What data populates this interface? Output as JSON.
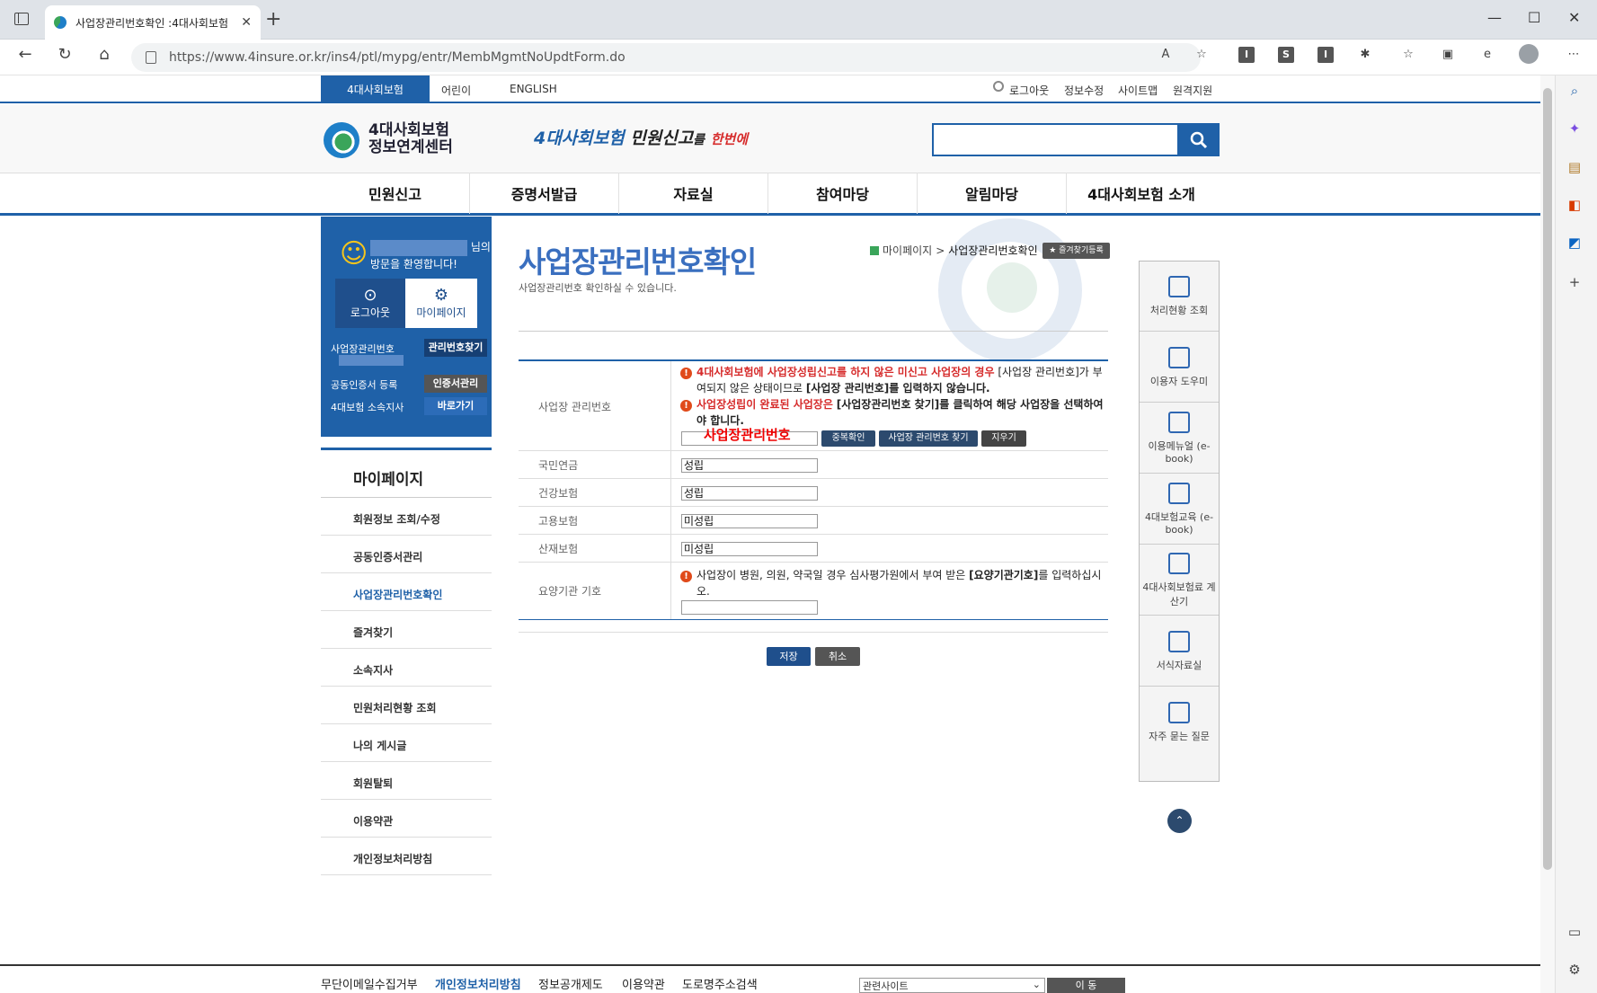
{
  "browser": {
    "tab_title": "사업장관리번호확인 :4대사회보험",
    "new_tab": "+",
    "url": "https://www.4insure.or.kr/ins4/ptl/mypg/entr/MembMgmtNoUpdtForm.do",
    "win_min": "—",
    "win_max": "☐",
    "win_close": "✕"
  },
  "util": {
    "brand": "4대사회보험",
    "kids": "어린이",
    "english": "ENGLISH",
    "logout": "로그아웃",
    "edit_info": "정보수정",
    "sitemap": "사이트맵",
    "remote": "원격지원"
  },
  "header": {
    "logo_line1": "4대사회보험",
    "logo_line2": "정보연계센터",
    "slogan_a": "4대사회보험",
    "slogan_b": "민원신고",
    "slogan_c": "를",
    "slogan_d": "한번에"
  },
  "gnb": [
    "민원신고",
    "증명서발급",
    "자료실",
    "참여마당",
    "알림마당",
    "4대사회보험 소개"
  ],
  "left_box": {
    "suffix": "님의",
    "welcome": "방문을 환영합니다!",
    "logout": "로그아웃",
    "mypage": "마이페이지",
    "row1": "사업장관리번호",
    "row1_btn": "관리번호찾기",
    "row2": "공동인증서 등록",
    "row2_btn": "인증서관리",
    "row3": "4대보험 소속지사",
    "row3_btn": "바로가기"
  },
  "lnb": {
    "title": "마이페이지",
    "items": [
      "회원정보 조회/수정",
      "공동인증서관리",
      "사업장관리번호확인",
      "즐겨찾기",
      "소속지사",
      "민원처리현황 조회",
      "나의 게시글",
      "회원탈퇴",
      "이용약관",
      "개인정보처리방침"
    ]
  },
  "content": {
    "title": "사업장관리번호확인",
    "subtitle": "사업장관리번호 확인하실 수 있습니다.",
    "breadcrumb_home": "마이페이지",
    "breadcrumb_sep": ">",
    "breadcrumb_current": "사업장관리번호확인",
    "fav_button": "즐겨찾기등록"
  },
  "form": {
    "bizno_label": "사업장 관리번호",
    "warn1_r": "4대사회보험에 사업장성립신고를 하지 않은 미신고 사업장의 경우",
    "warn1_a": "[사업장 관리번호]가 부여되지 않은 상태이므로",
    "warn1_k": "[사업장 관리번호]를 입력하지 않습니다.",
    "warn2_r": "사업장성립이 완료된 사업장은",
    "warn2_k": "[사업장관리번호 찾기]를 클릭하여 해당 사업장을 선택하여야 합니다.",
    "bizno_overlay": "사업장관리번호",
    "btn_dup": "중복확인",
    "btn_find": "사업장 관리번호 찾기",
    "btn_clear": "지우기",
    "rows": [
      {
        "label": "국민연금",
        "value": "성립"
      },
      {
        "label": "건강보험",
        "value": "성립"
      },
      {
        "label": "고용보험",
        "value": "미성립"
      },
      {
        "label": "산재보험",
        "value": "미성립"
      }
    ],
    "med_label": "요양기관 기호",
    "med_warn_a": "사업장이 병원, 의원, 약국일 경우 심사평가원에서 부여 받은",
    "med_warn_k": "[요양기관기호]",
    "med_warn_b": "를 입력하십시오.",
    "save": "저장",
    "cancel": "취소"
  },
  "quick": [
    "처리현황 조회",
    "이용자 도우미",
    "이용메뉴얼 (e-book)",
    "4대보험교육 (e-book)",
    "4대사회보험료 계산기",
    "서식자료실",
    "자주 묻는 질문"
  ],
  "top_button": "⌃",
  "footer": {
    "links": [
      "무단이메일수집거부",
      "개인정보처리방침",
      "정보공개제도",
      "이용약관",
      "도로명주소검색"
    ],
    "related": "관련사이트",
    "go": "이 동"
  },
  "colors": {
    "brand_blue": "#1f61a8",
    "title_blue": "#3a6fbf",
    "warn_red": "#d62b2b"
  },
  "icons": [
    "tabs-icon",
    "back-icon",
    "refresh-icon",
    "home-icon",
    "lock-icon",
    "read-aloud-icon",
    "favorite-add-icon",
    "extensions-icon",
    "favorites-icon",
    "collections-icon",
    "profile-icon",
    "more-icon",
    "search-icon",
    "copilot-icon",
    "tools-icon",
    "office-icon",
    "outlook-icon",
    "add-icon",
    "settings-icon"
  ]
}
